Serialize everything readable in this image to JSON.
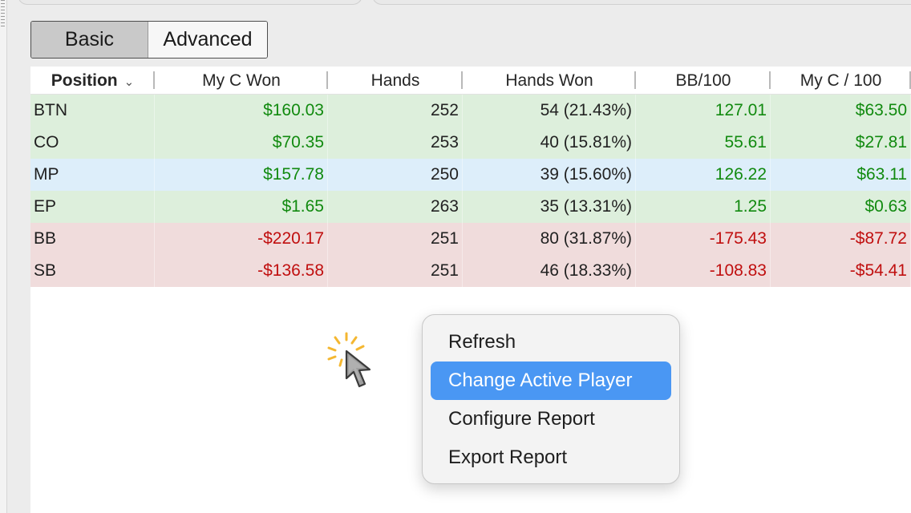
{
  "tabs": {
    "basic_label": "Basic",
    "advanced_label": "Advanced"
  },
  "table": {
    "headers": [
      "Position",
      "My C Won",
      "Hands",
      "Hands Won",
      "BB/100",
      "My C / 100"
    ],
    "rows": [
      {
        "position": "BTN",
        "won": "$160.03",
        "hands": "252",
        "hands_won": "54 (21.43%)",
        "bb100": "127.01",
        "c100": "$63.50",
        "tone": "green"
      },
      {
        "position": "CO",
        "won": "$70.35",
        "hands": "253",
        "hands_won": "40 (15.81%)",
        "bb100": "55.61",
        "c100": "$27.81",
        "tone": "green"
      },
      {
        "position": "MP",
        "won": "$157.78",
        "hands": "250",
        "hands_won": "39 (15.60%)",
        "bb100": "126.22",
        "c100": "$63.11",
        "tone": "blue"
      },
      {
        "position": "EP",
        "won": "$1.65",
        "hands": "263",
        "hands_won": "35 (13.31%)",
        "bb100": "1.25",
        "c100": "$0.63",
        "tone": "green"
      },
      {
        "position": "BB",
        "won": "-$220.17",
        "hands": "251",
        "hands_won": "80 (31.87%)",
        "bb100": "-175.43",
        "c100": "-$87.72",
        "tone": "red"
      },
      {
        "position": "SB",
        "won": "-$136.58",
        "hands": "251",
        "hands_won": "46 (18.33%)",
        "bb100": "-108.83",
        "c100": "-$54.41",
        "tone": "red"
      }
    ]
  },
  "context_menu": {
    "items": [
      "Refresh",
      "Change Active Player",
      "Configure Report",
      "Export Report"
    ],
    "selected_index": 1
  },
  "colors": {
    "positive_text": "#118a0f",
    "negative_text": "#c00f0f",
    "row_green": "#ddefdc",
    "row_blue": "#ddeefa",
    "row_red": "#f0dcdc",
    "menu_highlight": "#4a97f3"
  },
  "icons": {
    "sort": "chevron-down-icon",
    "cursor": "mouse-pointer-icon"
  }
}
